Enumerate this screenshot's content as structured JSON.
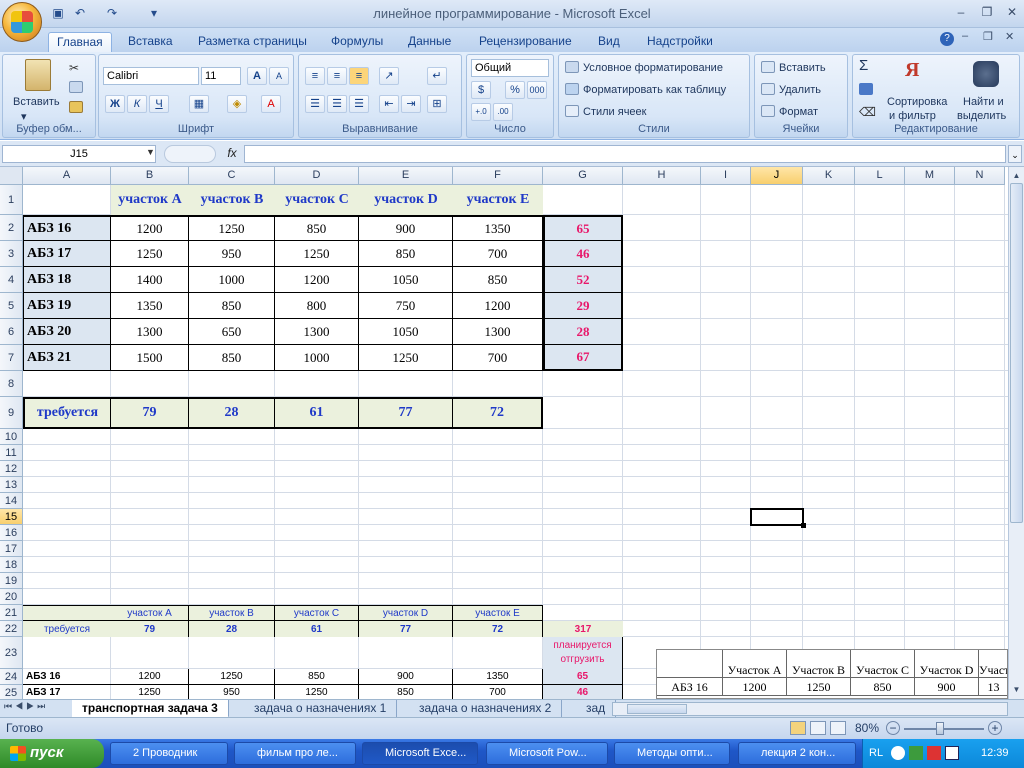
{
  "window": {
    "title": "линейное программирование - Microsoft Excel"
  },
  "ribbon_tabs": [
    "Главная",
    "Вставка",
    "Разметка страницы",
    "Формулы",
    "Данные",
    "Рецензирование",
    "Вид",
    "Надстройки"
  ],
  "ribbon": {
    "clipboard": {
      "label": "Буфер обм...",
      "paste": "Вставить"
    },
    "font": {
      "label": "Шрифт",
      "name": "Calibri",
      "size": "11",
      "bold": "Ж",
      "italic": "К",
      "underline": "Ч",
      "grow": "A",
      "shrink": "A"
    },
    "alignment": {
      "label": "Выравнивание"
    },
    "number": {
      "label": "Число",
      "format": "Общий",
      "percent": "%",
      "thousands": "000"
    },
    "styles": {
      "label": "Стили",
      "conditional": "Условное форматирование",
      "as_table": "Форматировать как таблицу",
      "cell_styles": "Стили ячеек"
    },
    "cells": {
      "label": "Ячейки",
      "insert": "Вставить",
      "delete": "Удалить",
      "format": "Формат"
    },
    "editing": {
      "label": "Редактирование",
      "sort": "Сортировка\nи фильтр",
      "sort1": "Сортировка",
      "sort2": "и фильтр",
      "find1": "Найти и",
      "find2": "выделить",
      "sigma": "Σ"
    }
  },
  "formula_bar": {
    "name_box": "J15",
    "fx": "fx",
    "value": ""
  },
  "columns": [
    "A",
    "B",
    "C",
    "D",
    "E",
    "F",
    "G",
    "H",
    "I",
    "J",
    "K",
    "L",
    "M",
    "N"
  ],
  "rows": [
    "1",
    "2",
    "3",
    "4",
    "5",
    "6",
    "7",
    "8",
    "9",
    "10",
    "11",
    "12",
    "13",
    "14",
    "15",
    "16",
    "17",
    "18",
    "19",
    "20",
    "21",
    "22",
    "23",
    "24",
    "25"
  ],
  "table": {
    "headers": [
      "участок A",
      "участок B",
      "участок C",
      "участок D",
      "участок E"
    ],
    "rows": [
      {
        "label": "АБЗ 16",
        "values": [
          "1200",
          "1250",
          "850",
          "900",
          "1350"
        ],
        "supply": "65"
      },
      {
        "label": "АБЗ 17",
        "values": [
          "1250",
          "950",
          "1250",
          "850",
          "700"
        ],
        "supply": "46"
      },
      {
        "label": "АБЗ 18",
        "values": [
          "1400",
          "1000",
          "1200",
          "1050",
          "850"
        ],
        "supply": "52"
      },
      {
        "label": "АБЗ 19",
        "values": [
          "1350",
          "850",
          "800",
          "750",
          "1200"
        ],
        "supply": "29"
      },
      {
        "label": "АБЗ 20",
        "values": [
          "1300",
          "650",
          "1300",
          "1050",
          "1300"
        ],
        "supply": "28"
      },
      {
        "label": "АБЗ 21",
        "values": [
          "1500",
          "850",
          "1000",
          "1250",
          "700"
        ],
        "supply": "67"
      }
    ],
    "required_label": "требуется",
    "required": [
      "79",
      "28",
      "61",
      "77",
      "72"
    ]
  },
  "table2": {
    "headers": [
      "участок A",
      "участок B",
      "участок C",
      "участок D",
      "участок E"
    ],
    "required_label": "требуется",
    "required": [
      "79",
      "28",
      "61",
      "77",
      "72"
    ],
    "total": "317",
    "planned_label1": "планируется",
    "planned_label2": "отгрузить",
    "rows": [
      {
        "label": "АБЗ 16",
        "values": [
          "1200",
          "1250",
          "850",
          "900",
          "1350"
        ],
        "supply": "65"
      },
      {
        "label": "АБЗ 17",
        "values": [
          "1250",
          "950",
          "1250",
          "850",
          "700"
        ],
        "supply": "46"
      }
    ]
  },
  "pasted_table": {
    "headers": [
      "Участок A",
      "Участок B",
      "Участок C",
      "Участок D",
      "Участ"
    ],
    "row_label": "АБЗ 16",
    "values": [
      "1200",
      "1250",
      "850",
      "900",
      "13"
    ]
  },
  "sheet_tabs": [
    "транспортная задача 3",
    "задача о назначениях 1",
    "задача о назначениях 2",
    "зад"
  ],
  "status": {
    "ready": "Готово",
    "zoom": "80%"
  },
  "taskbar": {
    "start": "пуск",
    "items": [
      "2 Проводник",
      "фильм про ле...",
      "Microsoft Exce...",
      "Microsoft Pow...",
      "Методы опти...",
      "лекция 2 кон..."
    ],
    "lang": "RL",
    "clock": "12:39"
  }
}
